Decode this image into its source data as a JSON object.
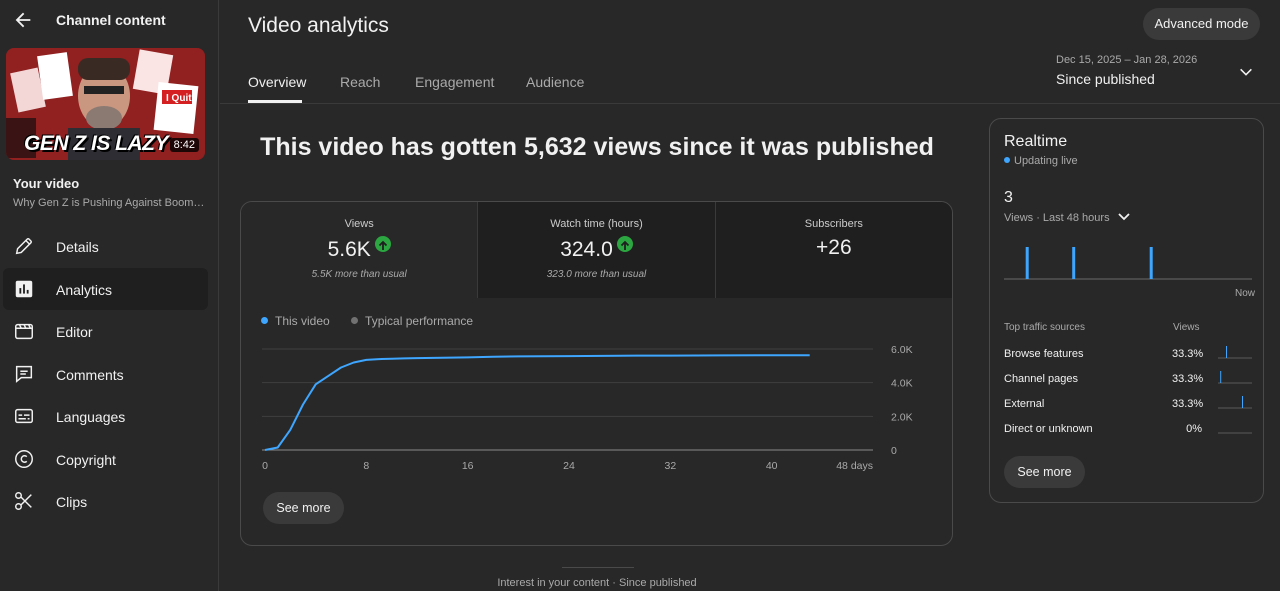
{
  "sidebar": {
    "header_title": "Channel content",
    "thumbnail": {
      "overlay_text": "GEN Z IS LAZY",
      "duration": "8:42",
      "sticker_1": "I Quit"
    },
    "section_label": "Your video",
    "video_title": "Why Gen Z is Pushing Against Boom…",
    "items": [
      {
        "label": "Details",
        "icon": "pencil-icon"
      },
      {
        "label": "Analytics",
        "icon": "bar-chart-icon",
        "active": true
      },
      {
        "label": "Editor",
        "icon": "clapperboard-icon"
      },
      {
        "label": "Comments",
        "icon": "comment-icon"
      },
      {
        "label": "Languages",
        "icon": "subtitles-icon"
      },
      {
        "label": "Copyright",
        "icon": "copyright-icon"
      },
      {
        "label": "Clips",
        "icon": "scissors-icon"
      }
    ]
  },
  "header": {
    "title": "Video analytics",
    "advanced_mode_label": "Advanced mode",
    "tabs": [
      {
        "label": "Overview",
        "active": true
      },
      {
        "label": "Reach"
      },
      {
        "label": "Engagement"
      },
      {
        "label": "Audience"
      }
    ],
    "date_range": "Dec 15, 2025 – Jan 28, 2026",
    "period_label": "Since published"
  },
  "overview": {
    "headline": "This video has gotten 5,632 views since it was published",
    "metrics": [
      {
        "label": "Views",
        "value": "5.6K",
        "trend": "up",
        "subtext": "5.5K more than usual"
      },
      {
        "label": "Watch time (hours)",
        "value": "324.0",
        "trend": "up",
        "subtext": "323.0 more than usual"
      },
      {
        "label": "Subscribers",
        "value": "+26",
        "trend": "",
        "subtext": ""
      }
    ],
    "legend": [
      {
        "label": "This video",
        "color": "#3ea6ff"
      },
      {
        "label": "Typical performance",
        "color": "#717171"
      }
    ],
    "see_more_label": "See more"
  },
  "chart_data": {
    "type": "line",
    "x_unit_label": "48 days",
    "x_ticks": [
      "0",
      "8",
      "16",
      "24",
      "32",
      "40",
      "48 days"
    ],
    "x_tick_values": [
      0,
      8,
      16,
      24,
      32,
      40,
      48
    ],
    "y_ticks": [
      "0",
      "2.0K",
      "4.0K",
      "6.0K"
    ],
    "y_tick_values": [
      0,
      2000,
      4000,
      6000
    ],
    "xlim": [
      0,
      48
    ],
    "ylim": [
      0,
      6000
    ],
    "grid": true,
    "series": [
      {
        "name": "This video",
        "color": "#3ea6ff",
        "x": [
          0,
          1,
          2,
          3,
          4,
          5,
          6,
          7,
          8,
          9,
          10,
          11,
          12,
          14,
          16,
          18,
          20,
          24,
          28,
          32,
          36,
          40,
          43
        ],
        "y": [
          0,
          150,
          1200,
          2700,
          3900,
          4400,
          4900,
          5200,
          5350,
          5400,
          5420,
          5440,
          5460,
          5480,
          5500,
          5540,
          5560,
          5580,
          5600,
          5610,
          5620,
          5630,
          5632
        ]
      }
    ]
  },
  "realtime": {
    "title": "Realtime",
    "status": "Updating live",
    "count": "3",
    "period_label": "Views · Last 48 hours",
    "now_label": "Now",
    "bars": [
      0,
      0,
      0,
      0,
      1,
      0,
      0,
      0,
      0,
      0,
      0,
      0,
      0,
      1,
      0,
      0,
      0,
      0,
      0,
      0,
      0,
      0,
      0,
      0,
      0,
      0,
      0,
      0,
      1,
      0,
      0,
      0,
      0,
      0,
      0,
      0,
      0,
      0,
      0,
      0,
      0,
      0,
      0,
      0,
      0,
      0,
      0,
      0
    ],
    "traffic_header": "Top traffic sources",
    "traffic_views_header": "Views",
    "traffic_sources": [
      {
        "label": "Browse features",
        "value": "33.3%",
        "spark_pos": 0.25
      },
      {
        "label": "Channel pages",
        "value": "33.3%",
        "spark_pos": 0.08
      },
      {
        "label": "External",
        "value": "33.3%",
        "spark_pos": 0.72
      },
      {
        "label": "Direct or unknown",
        "value": "0%",
        "spark_pos": -1
      }
    ],
    "see_more_label": "See more"
  },
  "footer": {
    "text": "Interest in your content · Since published"
  },
  "colors": {
    "accent_blue": "#3ea6ff",
    "trend_green": "#2ba640",
    "background": "#282828"
  }
}
